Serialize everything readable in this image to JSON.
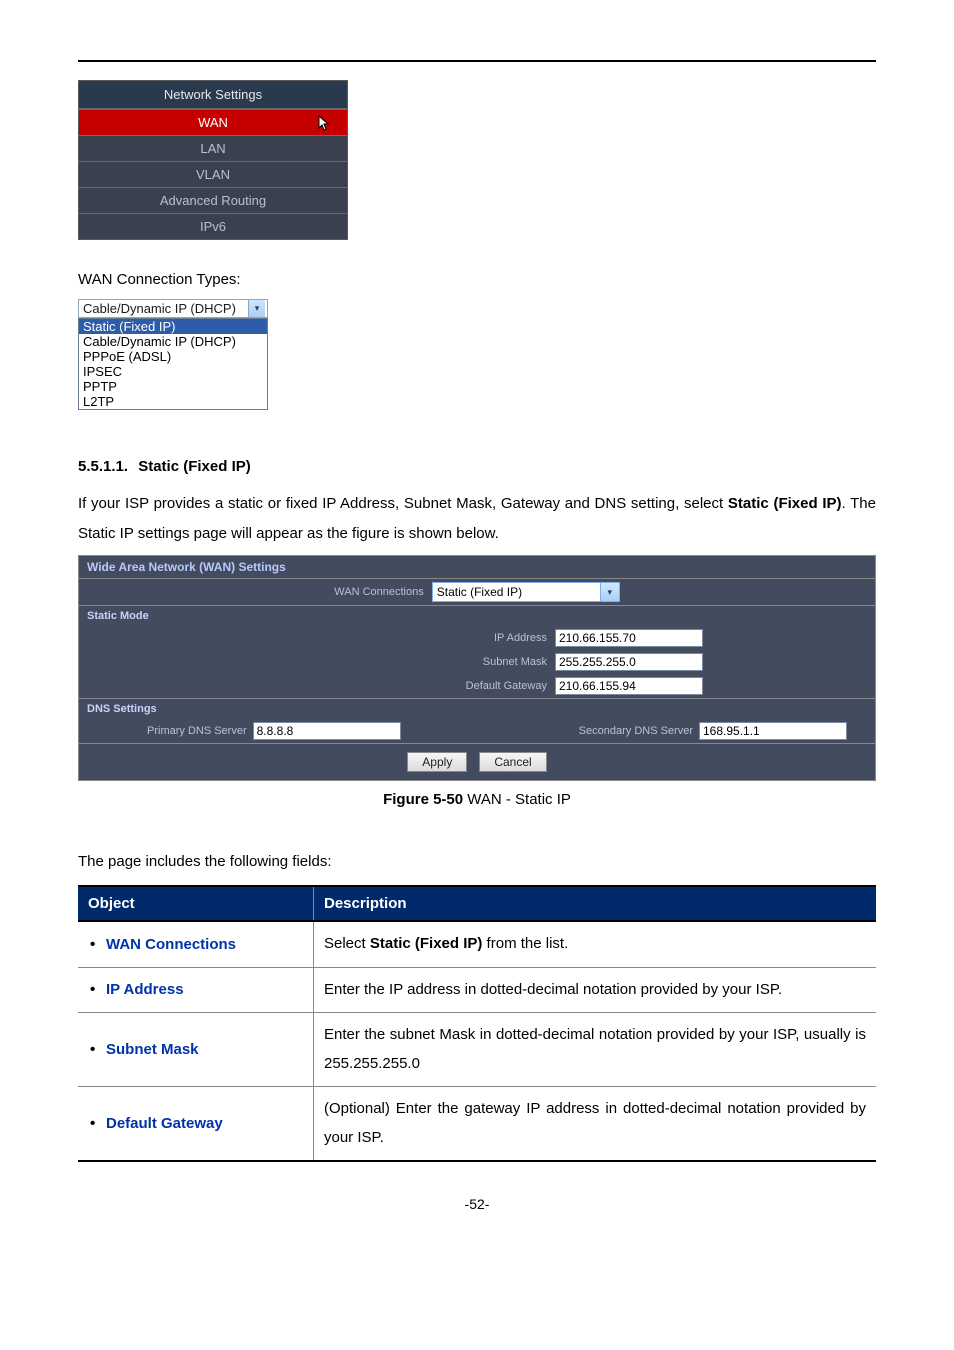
{
  "menu": {
    "header": "Network Settings",
    "items": [
      "WAN",
      "LAN",
      "VLAN",
      "Advanced Routing",
      "IPv6"
    ],
    "active_index": 0
  },
  "wan_types_label": "WAN Connection Types:",
  "dropdown": {
    "visible_value": "Cable/Dynamic IP (DHCP)",
    "options": [
      "Static (Fixed IP)",
      "Cable/Dynamic IP (DHCP)",
      "PPPoE (ADSL)",
      "IPSEC",
      "PPTP",
      "L2TP"
    ],
    "selected_index": 0
  },
  "section": {
    "number": "5.5.1.1.",
    "title": "Static (Fixed IP)",
    "para_before": "If your ISP provides a static or fixed IP Address, Subnet Mask, Gateway and DNS setting, select ",
    "para_bold": "Static (Fixed IP)",
    "para_after": ". The Static IP settings page will appear as the figure is shown below."
  },
  "panel": {
    "title": "Wide Area Network (WAN) Settings",
    "wan_conn_label": "WAN Connections",
    "wan_conn_value": "Static (Fixed IP)",
    "static_mode_label": "Static Mode",
    "ip_label": "IP Address",
    "ip_value": "210.66.155.70",
    "mask_label": "Subnet Mask",
    "mask_value": "255.255.255.0",
    "gw_label": "Default Gateway",
    "gw_value": "210.66.155.94",
    "dns_settings_label": "DNS Settings",
    "pdns_label": "Primary DNS Server",
    "pdns_value": "8.8.8.8",
    "sdns_label": "Secondary DNS Server",
    "sdns_value": "168.95.1.1",
    "apply": "Apply",
    "cancel": "Cancel"
  },
  "figure": {
    "label_bold": "Figure 5-50",
    "label_rest": " WAN - Static IP"
  },
  "fields_intro": "The page includes the following fields:",
  "fields_table": {
    "headers": [
      "Object",
      "Description"
    ],
    "rows": [
      {
        "object": "WAN Connections",
        "desc_pre": "Select ",
        "desc_bold": "Static (Fixed IP)",
        "desc_post": " from the list."
      },
      {
        "object": "IP Address",
        "desc": "Enter the IP address in dotted-decimal notation provided by your ISP."
      },
      {
        "object": "Subnet Mask",
        "desc": "Enter the subnet Mask in dotted-decimal notation provided by your ISP, usually is 255.255.255.0"
      },
      {
        "object": "Default Gateway",
        "desc": "(Optional) Enter the gateway IP address in dotted-decimal notation provided by your ISP."
      }
    ]
  },
  "page_number": "-52-"
}
